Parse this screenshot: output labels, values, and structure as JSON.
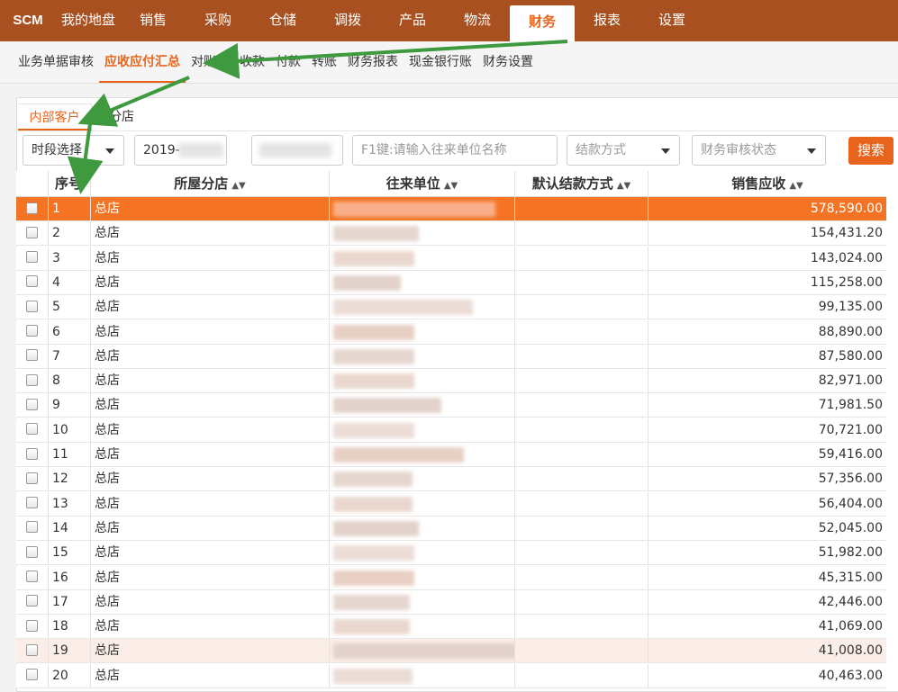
{
  "topnav": {
    "brand": "SCM",
    "items": [
      {
        "label": "我的地盘"
      },
      {
        "label": "销售"
      },
      {
        "label": "采购"
      },
      {
        "label": "仓储"
      },
      {
        "label": "调拨"
      },
      {
        "label": "产品"
      },
      {
        "label": "物流"
      },
      {
        "label": "财务",
        "active": true
      },
      {
        "label": "报表"
      },
      {
        "label": "设置"
      }
    ]
  },
  "subnav": {
    "items": [
      {
        "label": "业务单据审核"
      },
      {
        "label": "应收应付汇总",
        "active": true
      },
      {
        "label": "对账单"
      },
      {
        "label": "收款"
      },
      {
        "label": "付款"
      },
      {
        "label": "转账"
      },
      {
        "label": "财务报表"
      },
      {
        "label": "现金银行账"
      },
      {
        "label": "财务设置"
      }
    ]
  },
  "tabs": {
    "internal": "内部客户",
    "branch": "分店"
  },
  "filters": {
    "period": "时段选择",
    "date_start": "2019-",
    "keyword_placeholder": "F1键:请输入往来单位名称",
    "settlement": "结款方式",
    "audit_status": "财务审核状态",
    "search": "搜索"
  },
  "table": {
    "columns": {
      "index": "序号",
      "branch": "所屋分店",
      "party": "往来单位",
      "settlement": "默认结款方式",
      "receivable": "销售应收"
    },
    "rows": [
      {
        "index": "1",
        "branch": "总店",
        "amount": "578,590.00",
        "selected": true
      },
      {
        "index": "2",
        "branch": "总店",
        "amount": "154,431.20"
      },
      {
        "index": "3",
        "branch": "总店",
        "amount": "143,024.00"
      },
      {
        "index": "4",
        "branch": "总店",
        "amount": "115,258.00"
      },
      {
        "index": "5",
        "branch": "总店",
        "amount": "99,135.00"
      },
      {
        "index": "6",
        "branch": "总店",
        "amount": "88,890.00"
      },
      {
        "index": "7",
        "branch": "总店",
        "amount": "87,580.00"
      },
      {
        "index": "8",
        "branch": "总店",
        "amount": "82,971.00"
      },
      {
        "index": "9",
        "branch": "总店",
        "amount": "71,981.50"
      },
      {
        "index": "10",
        "branch": "总店",
        "amount": "70,721.00"
      },
      {
        "index": "11",
        "branch": "总店",
        "amount": "59,416.00"
      },
      {
        "index": "12",
        "branch": "总店",
        "amount": "57,356.00"
      },
      {
        "index": "13",
        "branch": "总店",
        "amount": "56,404.00"
      },
      {
        "index": "14",
        "branch": "总店",
        "amount": "52,045.00"
      },
      {
        "index": "15",
        "branch": "总店",
        "amount": "51,982.00"
      },
      {
        "index": "16",
        "branch": "总店",
        "amount": "45,315.00"
      },
      {
        "index": "17",
        "branch": "总店",
        "amount": "42,446.00"
      },
      {
        "index": "18",
        "branch": "总店",
        "amount": "41,069.00"
      },
      {
        "index": "19",
        "branch": "总店",
        "amount": "41,008.00",
        "hover": true
      },
      {
        "index": "20",
        "branch": "总店",
        "amount": "40,463.00"
      }
    ]
  },
  "colors": {
    "nav_bg": "#a8501f",
    "accent": "#e8641c",
    "selected_row": "#f47424",
    "hover_row": "#fbeee8",
    "arrow": "#3f9a3f"
  }
}
